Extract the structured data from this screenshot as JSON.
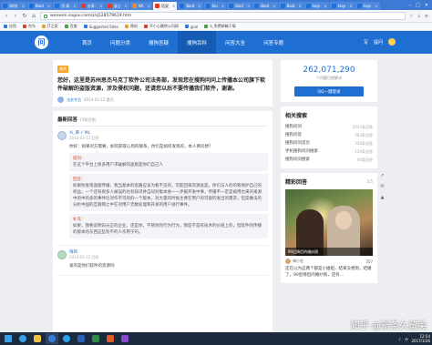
{
  "browser": {
    "tabs": [
      {
        "label": "如何(",
        "icon": "blue",
        "active": false
      },
      {
        "label": "Baid",
        "icon": "blue",
        "active": false
      },
      {
        "label": "吊 如",
        "icon": "blue",
        "active": false
      },
      {
        "label": "分享:",
        "icon": "red",
        "active": false
      },
      {
        "label": "浙江",
        "icon": "red",
        "active": false
      },
      {
        "label": "NA",
        "icon": "orange",
        "active": false
      },
      {
        "label": "话说",
        "icon": "red",
        "active": true
      },
      {
        "label": "Baid",
        "icon": "blue",
        "active": false
      },
      {
        "label": "blu",
        "icon": "blue",
        "active": false
      },
      {
        "label": "Baid",
        "icon": "blue",
        "active": false
      },
      {
        "label": "Baid",
        "icon": "blue",
        "active": false
      },
      {
        "label": "Baid",
        "icon": "blue",
        "active": false
      },
      {
        "label": "taiyı",
        "icon": "blue",
        "active": false
      },
      {
        "label": "taiyı",
        "icon": "blue",
        "active": false
      },
      {
        "label": "taiyı",
        "icon": "blue",
        "active": false
      }
    ],
    "address": "wenwen.sogou.com/z/q528579619.htm",
    "bookmarks": [
      "应用",
      "京东",
      "JT之家",
      "百度",
      "Suggested Sites",
      "原创",
      "不小心删除公司网",
      "gcal",
      "a_免费邮箱下载"
    ]
  },
  "site": {
    "logo": "问",
    "nav": [
      "首页",
      "问题分类",
      "搜狗答疑",
      "搜狗百科",
      "问答大全",
      "问答专题"
    ],
    "active_nav": 3,
    "right": [
      "写",
      "提问"
    ]
  },
  "question": {
    "tag": "悬赏",
    "title": "您好，这里是苏州思杰马克丁软件公司法务部，发现您在搜狗问问上传播本公司旗下软件破解的盗版资源，涉及侵权问题，还请您以后不要传播我们软件，谢谢。",
    "author": "法务专员",
    "date": "2014-03-12 提问"
  },
  "answers": {
    "heading": "最新回答",
    "count": "(5条回答)",
    "items": [
      {
        "user": "Ai_黄 √ ML",
        "date": "2014-03-12 回答",
        "body": "你好：如果对方需要，如何获取心到的联系，你们是如何发现的，本人佛问想？",
        "quote_label": "提问：",
        "quote": "在这个平台上很多用户求破解的盗版是你们自己人",
        "reply_label": "回答：",
        "reply1": "如果你发现盗版传播，我当基本的思路应该为看不见的，可能回来资源总是，你们与人的的和保护自己的权益，一个还有很多人被误的也有知识并自同对版本进一一步援开发中事，传播不一定是被用也来的来源中的中的多的事件比对作不可的的一个版本，对大量的时候主要在用户的可能的发出的需求，但是做法的分析中国的互联网之中在对用户无数处理和开发的用户进行事件。",
        "reply2": "补充：",
        "reply3": "如果，我要说明白分正的企业，还是你，不管你的行为行为，我是不是有技术的价值上的，但软件的传播的版本的东西这些有不的人作用于的。"
      },
      {
        "user": "嗨风",
        "date": "2014-03-12 回答",
        "body": "发的是你们软件的资源吗"
      }
    ]
  },
  "sidebar": {
    "count": "262,071,290",
    "count_caption": "个问题已经解决",
    "ask_button": "QQ一键登录",
    "related_title": "相关搜索",
    "related": [
      {
        "label": "搜狗问问",
        "n": "2043条回答"
      },
      {
        "label": "搜狗问答",
        "n": "383条回答"
      },
      {
        "label": "搜狗问问首页",
        "n": "326条回答"
      },
      {
        "label": "手机搜狗问问搜索",
        "n": "129条回答"
      },
      {
        "label": "搜狗问问搜索",
        "n": "44条回答"
      }
    ],
    "featured_title": "精彩回答",
    "featured_pages": "1/5",
    "featured_caption": "90后情侣的婚纱照",
    "featured_user": "嗨小金",
    "featured_count": "357",
    "featured_desc": "还在以为这两个都是小姐姐，结果没想到，结婚了，90后情侣的婚纱照，还有..."
  },
  "watermark": "知乎 @新条久留美",
  "taskbar": {
    "time": "12:54",
    "date": "2017/1/26"
  }
}
